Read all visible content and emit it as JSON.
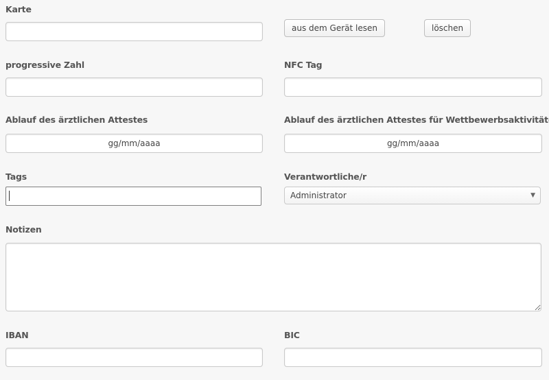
{
  "form": {
    "karte": {
      "label": "Karte",
      "value": "",
      "read_button": "aus dem Gerät lesen",
      "delete_button": "löschen"
    },
    "progressive_zahl": {
      "label": "progressive Zahl",
      "value": ""
    },
    "nfc_tag": {
      "label": "NFC Tag",
      "value": ""
    },
    "attest": {
      "label": "Ablauf des ärztlichen Attestes",
      "placeholder": "gg/mm/aaaa"
    },
    "attest_wettbewerb": {
      "label": "Ablauf des ärztlichen Attestes für Wettbewerbsaktivitäten",
      "placeholder": "gg/mm/aaaa"
    },
    "tags": {
      "label": "Tags",
      "value": ""
    },
    "verantwortliche": {
      "label": "Verantwortliche/r",
      "selected": "Administrator"
    },
    "notizen": {
      "label": "Notizen",
      "value": ""
    },
    "iban": {
      "label": "IBAN",
      "value": ""
    },
    "bic": {
      "label": "BIC",
      "value": ""
    }
  },
  "icons": {
    "dropdown": "triangle-down"
  }
}
